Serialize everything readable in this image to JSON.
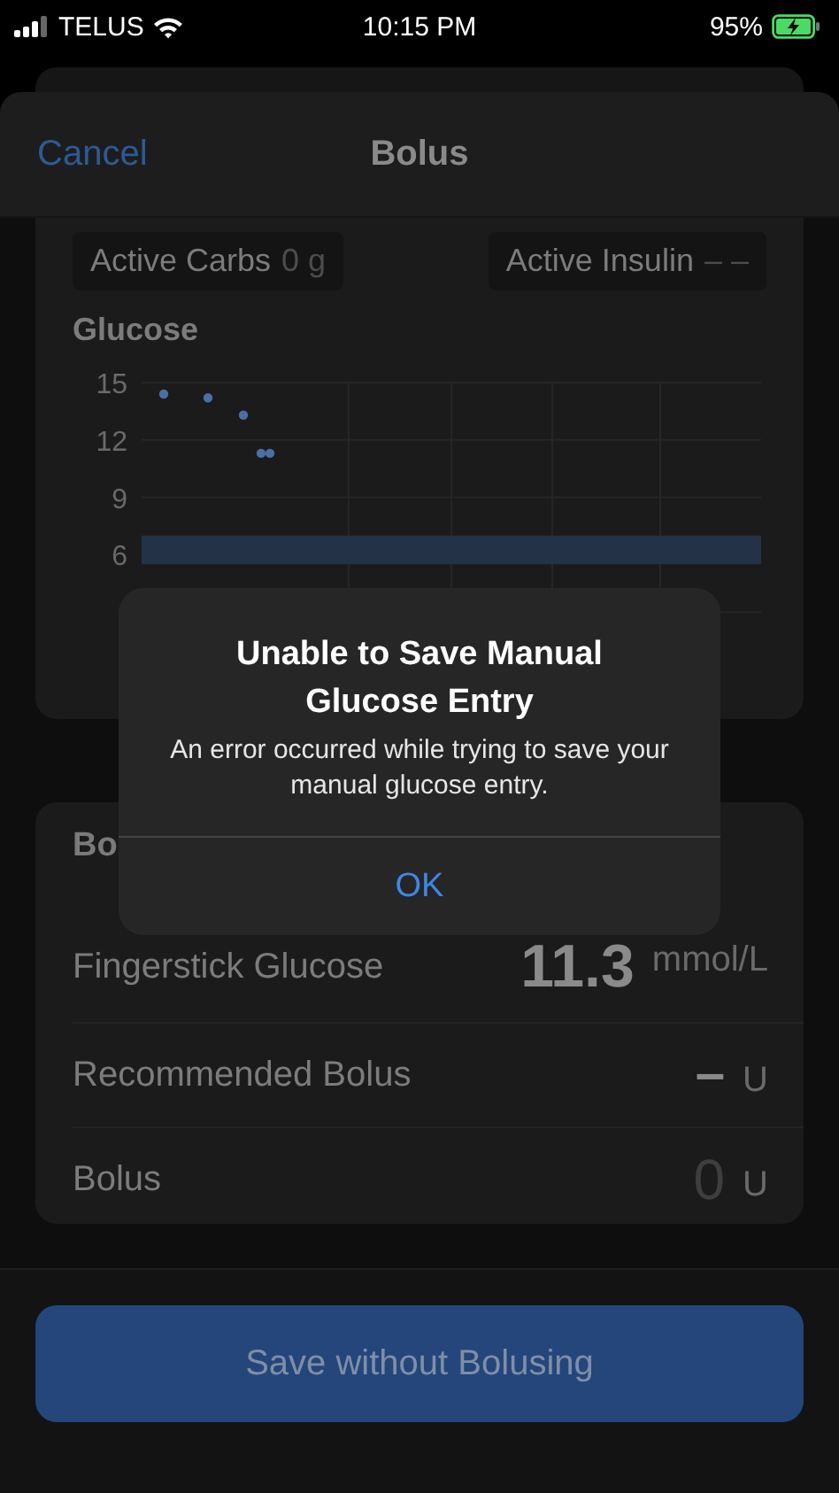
{
  "status_bar": {
    "carrier": "TELUS",
    "time": "10:15 PM",
    "battery": "95%",
    "charging": true
  },
  "nav": {
    "cancel": "Cancel",
    "title": "Bolus"
  },
  "summary": [
    {
      "label": "Active Carbs",
      "value": "0 g"
    },
    {
      "label": "Active Insulin",
      "value": "– –"
    }
  ],
  "glucose_chart": {
    "title": "Glucose",
    "chart_data": {
      "type": "scatter",
      "categories": [
        null,
        null,
        null,
        null,
        null,
        null,
        null,
        null,
        null,
        null,
        null,
        null,
        null,
        null,
        null,
        null,
        null,
        null,
        null,
        null,
        null,
        null,
        null,
        null,
        null,
        null,
        null,
        null,
        null,
        null,
        null,
        null,
        null,
        null,
        null,
        null,
        null,
        null,
        null,
        null,
        null,
        null,
        null,
        null,
        null,
        null,
        null,
        null,
        null,
        null,
        null,
        null,
        null,
        null,
        null,
        null,
        null,
        null,
        null,
        null,
        null,
        null,
        null,
        null,
        null,
        null,
        null,
        null,
        null,
        null
      ],
      "values": [
        null,
        null,
        14.4,
        null,
        null,
        null,
        null,
        14.2,
        null,
        null,
        null,
        13.3,
        null,
        11.3,
        11.3,
        null,
        null,
        null,
        null,
        null,
        null,
        null,
        null,
        null,
        null,
        null,
        null,
        null,
        null,
        null,
        null,
        null,
        null,
        null,
        null,
        null,
        null,
        null,
        null,
        null,
        null,
        null,
        null,
        null,
        null,
        null,
        null,
        null,
        null,
        null,
        null,
        null,
        null,
        null,
        null,
        null,
        null,
        null,
        null,
        null,
        null,
        null,
        null,
        null,
        null,
        null,
        null,
        null,
        null,
        null
      ],
      "ylim": [
        3,
        15
      ],
      "yticks": [
        15,
        12,
        9,
        6
      ],
      "grid": true,
      "bands": [
        {
          "axis": "y",
          "from": 5.5,
          "to": 7.0
        }
      ]
    }
  },
  "bolus_section": {
    "header": "Bo",
    "rows": [
      {
        "kind": "entry",
        "label": "Fingerstick Glucose",
        "value": "11.3",
        "unit": "mmol/L"
      },
      {
        "kind": "recommended",
        "label": "Recommended Bolus",
        "value": "–",
        "unit": "U"
      },
      {
        "kind": "input",
        "label": "Bolus",
        "value": "0",
        "unit": "U"
      }
    ]
  },
  "save_button": {
    "label": "Save without Bolusing",
    "disabled": true
  },
  "alert": {
    "title": "Unable to Save Manual Glucose Entry",
    "message": "An error occurred while trying to save your manual glucose entry.",
    "button": "OK"
  }
}
